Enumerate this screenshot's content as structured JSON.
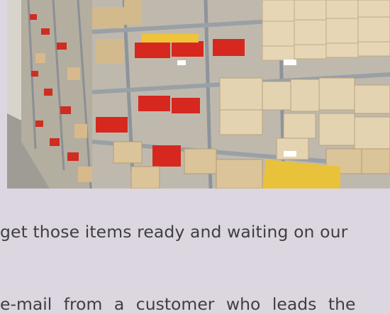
{
  "article": {
    "image_alt": "warehouse shelving with boxes",
    "line_1": "get those items ready and waiting on our",
    "line_2": "e-mail from a customer who leads the"
  }
}
